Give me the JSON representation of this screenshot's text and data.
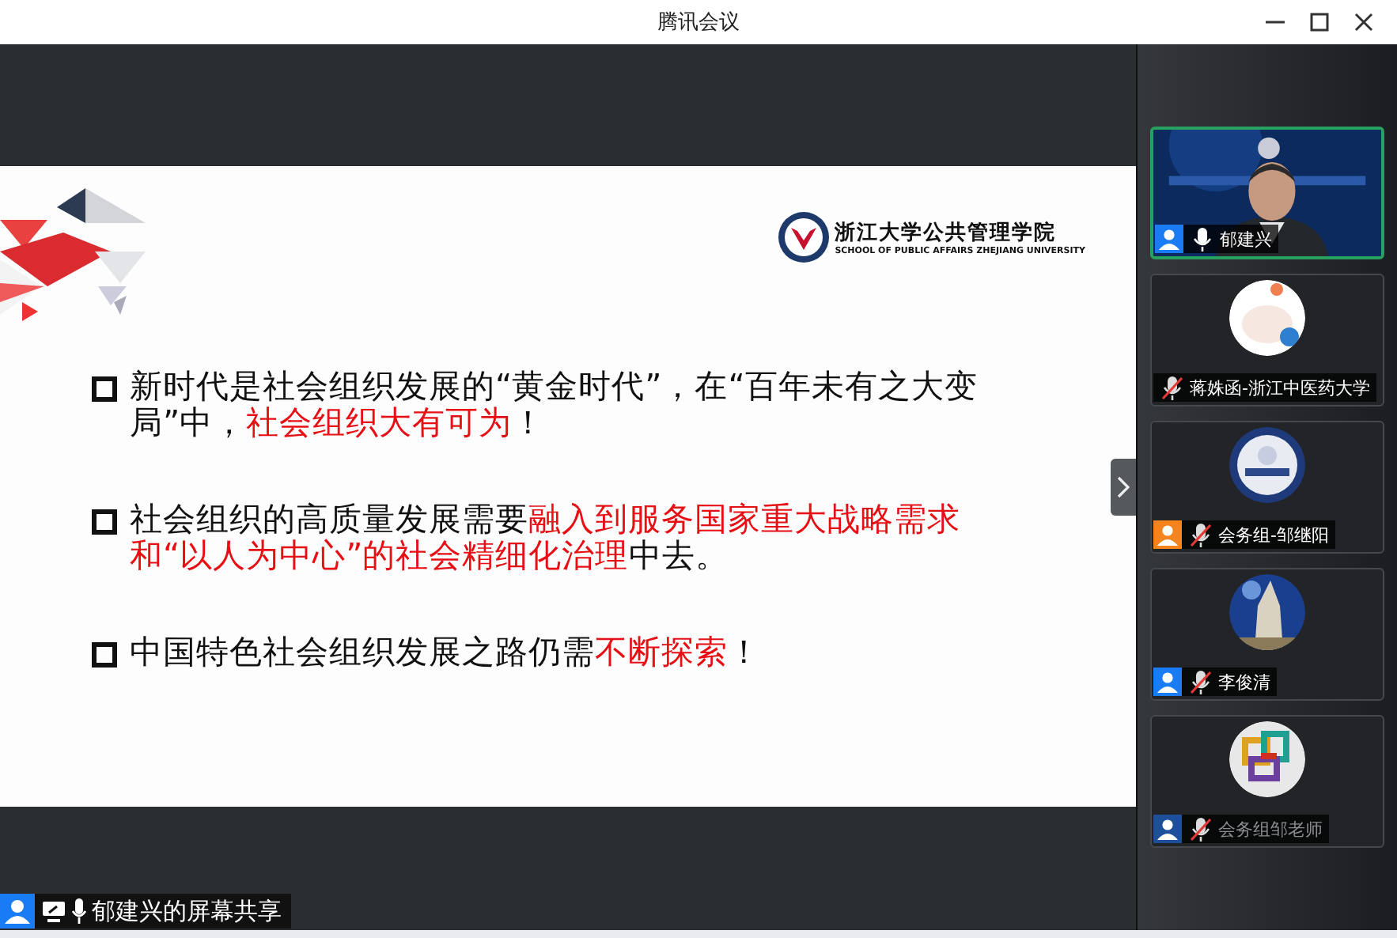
{
  "window": {
    "title": "腾讯会议"
  },
  "slide": {
    "logo": {
      "name_cn": "浙江大学公共管理学院",
      "name_en": "SCHOOL OF PUBLIC AFFAIRS  ZHEJIANG UNIVERSITY"
    },
    "bullets": [
      [
        {
          "text": "新时代是社会组织发展的“黄金时代”，在“百年未有之大变局”中，",
          "highlight": false
        },
        {
          "text": "社会组织大有可为",
          "highlight": true
        },
        {
          "text": "！",
          "highlight": false
        }
      ],
      [
        {
          "text": "社会组织的高质量发展需要",
          "highlight": false
        },
        {
          "text": "融入到服务国家重大战略需求和“以人为中心”的社会精细化治理",
          "highlight": true
        },
        {
          "text": "中去。",
          "highlight": false
        }
      ],
      [
        {
          "text": "中国特色社会组织发展之路仍需",
          "highlight": false
        },
        {
          "text": "不断探索",
          "highlight": true
        },
        {
          "text": "！",
          "highlight": false
        }
      ]
    ]
  },
  "share_label": {
    "text": "郁建兴的屏幕共享"
  },
  "participants": [
    {
      "name": "郁建兴",
      "kind": "video",
      "speaking": true,
      "mic_muted": false,
      "disabled": false,
      "color": "#1a7cf5"
    },
    {
      "name": "蒋姝函-浙江中医药大学",
      "kind": "avatar",
      "speaking": false,
      "mic_muted": true,
      "disabled": false
    },
    {
      "name": "会务组-邹继阳",
      "kind": "avatar",
      "speaking": false,
      "mic_muted": true,
      "disabled": false,
      "color": "#f5841f"
    },
    {
      "name": "李俊清",
      "kind": "avatar",
      "speaking": false,
      "mic_muted": true,
      "disabled": false,
      "color": "#1a7cf5"
    },
    {
      "name": "会务组邹老师",
      "kind": "avatar",
      "speaking": false,
      "mic_muted": true,
      "disabled": true,
      "color": "#1d4f9a"
    }
  ]
}
